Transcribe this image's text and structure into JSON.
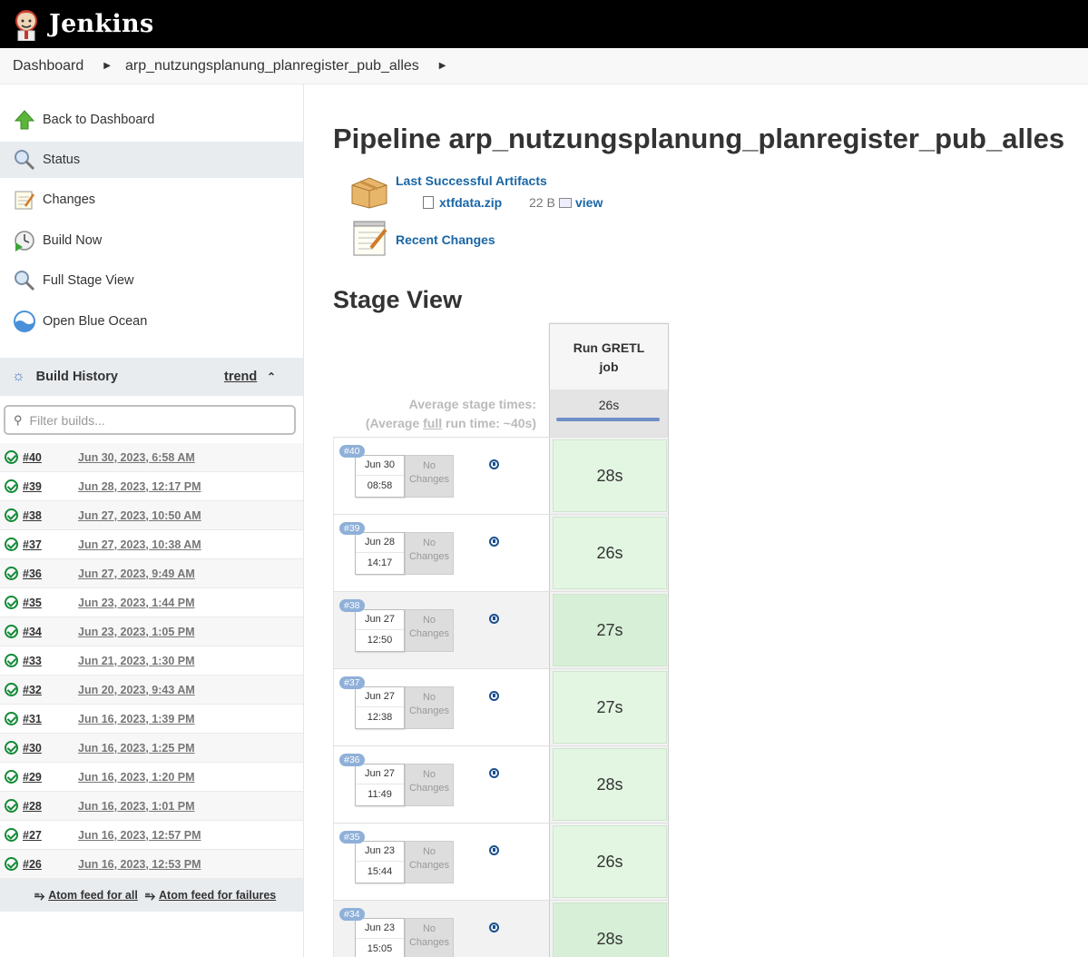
{
  "header": {
    "title": "Jenkins"
  },
  "breadcrumb": {
    "items": [
      "Dashboard",
      "arp_nutzungsplanung_planregister_pub_alles"
    ]
  },
  "sidebar": {
    "tasks": [
      {
        "label": "Back to Dashboard",
        "icon": "up-arrow-icon"
      },
      {
        "label": "Status",
        "icon": "magnifier-icon"
      },
      {
        "label": "Changes",
        "icon": "notepad-icon"
      },
      {
        "label": "Build Now",
        "icon": "clock-play-icon"
      },
      {
        "label": "Full Stage View",
        "icon": "magnifier-icon"
      },
      {
        "label": "Open Blue Ocean",
        "icon": "blue-ocean-icon"
      }
    ],
    "build_history": {
      "title": "Build History",
      "trend": "trend",
      "filter_placeholder": "Filter builds...",
      "builds": [
        {
          "num": "#40",
          "date": "Jun 30, 2023, 6:58 AM"
        },
        {
          "num": "#39",
          "date": "Jun 28, 2023, 12:17 PM"
        },
        {
          "num": "#38",
          "date": "Jun 27, 2023, 10:50 AM"
        },
        {
          "num": "#37",
          "date": "Jun 27, 2023, 10:38 AM"
        },
        {
          "num": "#36",
          "date": "Jun 27, 2023, 9:49 AM"
        },
        {
          "num": "#35",
          "date": "Jun 23, 2023, 1:44 PM"
        },
        {
          "num": "#34",
          "date": "Jun 23, 2023, 1:05 PM"
        },
        {
          "num": "#33",
          "date": "Jun 21, 2023, 1:30 PM"
        },
        {
          "num": "#32",
          "date": "Jun 20, 2023, 9:43 AM"
        },
        {
          "num": "#31",
          "date": "Jun 16, 2023, 1:39 PM"
        },
        {
          "num": "#30",
          "date": "Jun 16, 2023, 1:25 PM"
        },
        {
          "num": "#29",
          "date": "Jun 16, 2023, 1:20 PM"
        },
        {
          "num": "#28",
          "date": "Jun 16, 2023, 1:01 PM"
        },
        {
          "num": "#27",
          "date": "Jun 16, 2023, 12:57 PM"
        },
        {
          "num": "#26",
          "date": "Jun 16, 2023, 12:53 PM"
        }
      ],
      "feed_all": "Atom feed for all",
      "feed_failures": "Atom feed for failures"
    }
  },
  "main": {
    "title": "Pipeline arp_nutzungsplanung_planregister_pub_alles",
    "artifacts_label": "Last Successful Artifacts",
    "artifact_file": "xtfdata.zip",
    "artifact_size": "22 B",
    "artifact_view": "view",
    "recent_changes": "Recent Changes",
    "stage_view_title": "Stage View",
    "stage_name_line1": "Run GRETL",
    "stage_name_line2": "job",
    "avg_label_line1": "Average stage times:",
    "avg_label_prefix": "(Average ",
    "avg_label_full": "full",
    "avg_label_suffix": " run time: ~40s)",
    "avg_time": "26s",
    "no_changes_line1": "No",
    "no_changes_line2": "Changes",
    "runs": [
      {
        "badge": "#40",
        "date": "Jun 30",
        "time": "08:58",
        "duration": "28s"
      },
      {
        "badge": "#39",
        "date": "Jun 28",
        "time": "14:17",
        "duration": "26s"
      },
      {
        "badge": "#38",
        "date": "Jun 27",
        "time": "12:50",
        "duration": "27s"
      },
      {
        "badge": "#37",
        "date": "Jun 27",
        "time": "12:38",
        "duration": "27s"
      },
      {
        "badge": "#36",
        "date": "Jun 27",
        "time": "11:49",
        "duration": "28s"
      },
      {
        "badge": "#35",
        "date": "Jun 23",
        "time": "15:44",
        "duration": "26s"
      },
      {
        "badge": "#34",
        "date": "Jun 23",
        "time": "15:05",
        "duration": "28s"
      }
    ]
  }
}
